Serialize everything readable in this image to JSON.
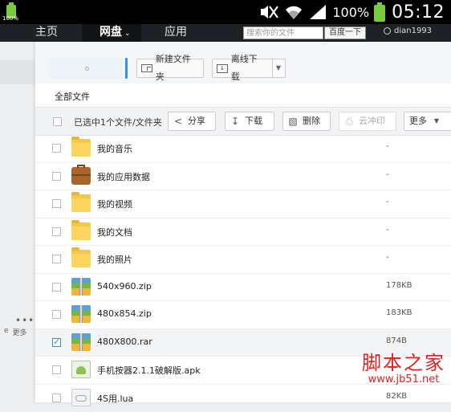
{
  "status_bar": {
    "battery_left_label": "100%",
    "battery_percent": "100%",
    "time": "05:12"
  },
  "top_nav": {
    "home": "主页",
    "netdisk": "网盘",
    "apps": "应用",
    "search_placeholder": "搜索你的文件",
    "search_button": "百度一下",
    "username": "dian1993"
  },
  "left_panel": {
    "more_label": "更多",
    "partial_label": "e"
  },
  "toolbar": {
    "new_folder": "新建文件夹",
    "offline_download": "离线下载"
  },
  "breadcrumb": "全部文件",
  "action_bar": {
    "selection_text": "已选中1个文件/文件夹",
    "share": "分享",
    "download": "下载",
    "delete": "删除",
    "cloud_print": "云冲印",
    "more": "更多"
  },
  "files": [
    {
      "name": "我的音乐",
      "size": "-",
      "type": "folder",
      "checked": false
    },
    {
      "name": "我的应用数据",
      "size": "-",
      "type": "appdata",
      "checked": false
    },
    {
      "name": "我的视频",
      "size": "-",
      "type": "folder",
      "checked": false
    },
    {
      "name": "我的文档",
      "size": "-",
      "type": "folder",
      "checked": false
    },
    {
      "name": "我的照片",
      "size": "-",
      "type": "folder",
      "checked": false
    },
    {
      "name": "540x960.zip",
      "size": "178KB",
      "type": "zip",
      "checked": false
    },
    {
      "name": "480x854.zip",
      "size": "183KB",
      "type": "zip",
      "checked": false
    },
    {
      "name": "480X800.rar",
      "size": "874B",
      "type": "zip",
      "checked": true
    },
    {
      "name": "手机按器2.1.1破解版.apk",
      "size": "",
      "type": "apk",
      "checked": false
    },
    {
      "name": "4S用.lua",
      "size": "82KB",
      "type": "lua",
      "checked": false
    }
  ],
  "watermark": {
    "cn": "脚本之家",
    "url": "www.jb51.net"
  }
}
